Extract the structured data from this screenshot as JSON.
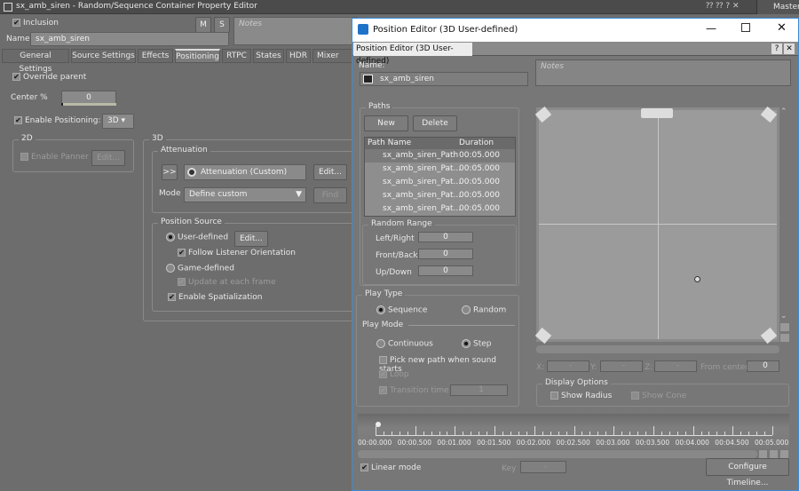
{
  "main": {
    "title": "sx_amb_siren - Random/Sequence Container Property Editor",
    "title_icons": [
      "help-icon",
      "help-icon",
      "help-icon",
      "close-icon"
    ],
    "master": "Master",
    "inclusion": "Inclusion",
    "m": "M",
    "s": "S",
    "name_label": "Name",
    "name_value": "sx_amb_siren",
    "notes": "Notes",
    "tabs": [
      "General Settings",
      "Source Settings",
      "Effects",
      "Positioning",
      "RTPC",
      "States",
      "HDR",
      "Mixer Plu"
    ],
    "active_tab": "Positioning",
    "override_parent": "Override parent",
    "center_label": "Center %",
    "center_value": "0",
    "enable_positioning": "Enable Positioning:",
    "positioning_mode": "3D",
    "g2d": "2D",
    "enable_panner": "Enable Panner",
    "edit": "Edit...",
    "g3d": "3D",
    "attenuation": "Attenuation",
    "arrows": ">>",
    "attenuation_value": "Attenuation (Custom)",
    "mode_label": "Mode",
    "mode_value": "Define custom",
    "find": "Find",
    "position_source": "Position Source",
    "user_defined": "User-defined",
    "follow_listener": "Follow Listener Orientation",
    "game_defined": "Game-defined",
    "update_each_frame": "Update at each frame",
    "enable_spatialization": "Enable Spatialization"
  },
  "dialog": {
    "title": "Position Editor (3D User-defined)",
    "tab": "Position Editor (3D User-defined)",
    "name_label": "Name:",
    "name_value": "sx_amb_siren",
    "notes": "Notes",
    "paths": "Paths",
    "new": "New",
    "delete": "Delete",
    "col_name": "Path Name",
    "col_duration": "Duration",
    "rows": [
      {
        "name": "sx_amb_siren_Path",
        "duration": "00:05.000"
      },
      {
        "name": "sx_amb_siren_Pat...",
        "duration": "00:05.000"
      },
      {
        "name": "sx_amb_siren_Pat...",
        "duration": "00:05.000"
      },
      {
        "name": "sx_amb_siren_Pat...",
        "duration": "00:05.000"
      },
      {
        "name": "sx_amb_siren_Pat...",
        "duration": "00:05.000"
      }
    ],
    "random_range": "Random Range",
    "left_right": "Left/Right",
    "front_back": "Front/Back",
    "up_down": "Up/Down",
    "lr_value": "0",
    "fb_value": "0",
    "ud_value": "0",
    "play_type": "Play Type",
    "sequence": "Sequence",
    "random": "Random",
    "play_mode": "Play Mode",
    "continuous": "Continuous",
    "step": "Step",
    "pick_new": "Pick new path when sound starts",
    "loop": "Loop",
    "transition": "Transition time",
    "transition_value": "1",
    "x": "X:",
    "y": "Y:",
    "z": "Z:",
    "dash": "-",
    "from_center": "From center:",
    "from_center_value": "0",
    "display_options": "Display Options",
    "show_radius": "Show Radius",
    "show_cone": "Show Cone",
    "timeline": [
      "00:00.000",
      "00:00.500",
      "00:01.000",
      "00:01.500",
      "00:02.000",
      "00:02.500",
      "00:03.000",
      "00:03.500",
      "00:04.000",
      "00:04.500",
      "00:05.000"
    ],
    "linear_mode": "Linear mode",
    "key": "Key",
    "key_value": "-",
    "configure": "Configure Timeline..."
  }
}
